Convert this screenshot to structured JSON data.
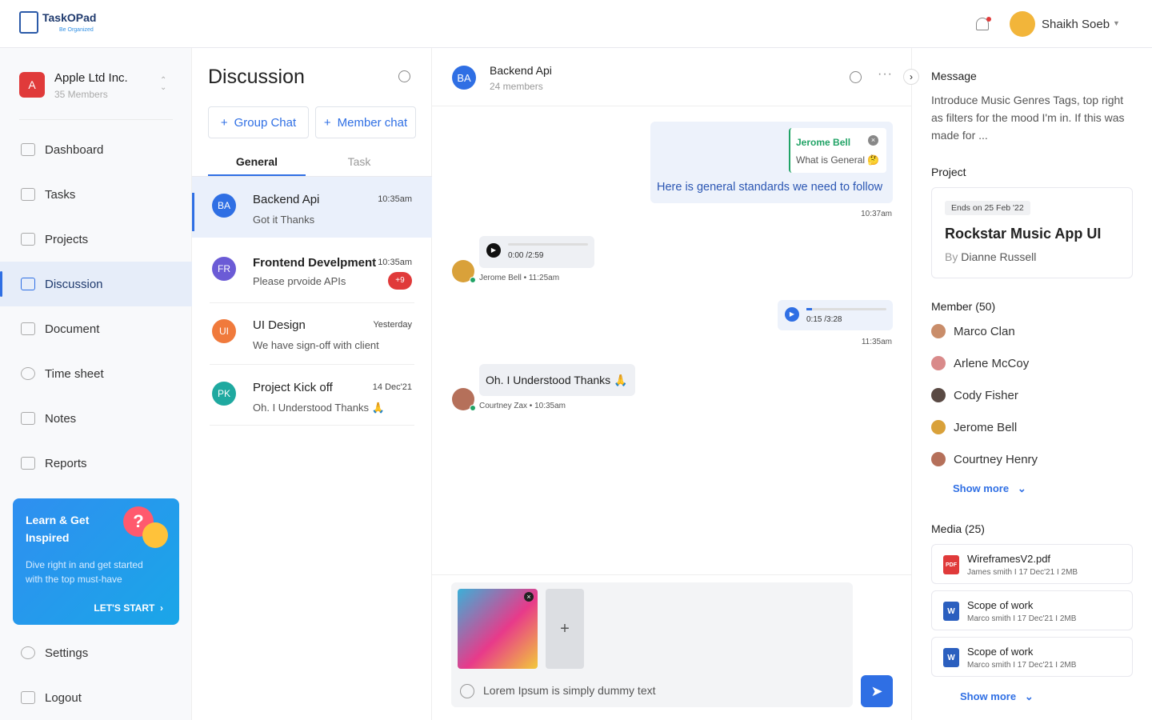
{
  "header": {
    "logo": "TaskOPad",
    "tagline": "Be Organized",
    "user": "Shaikh Soeb"
  },
  "workspace": {
    "initial": "A",
    "name": "Apple Ltd Inc.",
    "members": "35 Members"
  },
  "nav": [
    {
      "label": "Dashboard"
    },
    {
      "label": "Tasks"
    },
    {
      "label": "Projects"
    },
    {
      "label": "Discussion",
      "active": true
    },
    {
      "label": "Document"
    },
    {
      "label": "Time sheet"
    },
    {
      "label": "Notes"
    },
    {
      "label": "Reports"
    }
  ],
  "promo": {
    "title": "Learn & Get Inspired",
    "text": "Dive right in and get started with the top must-have",
    "cta": "LET'S START"
  },
  "bottom_nav": [
    {
      "label": "Settings"
    },
    {
      "label": "Logout"
    }
  ],
  "discussion": {
    "title": "Discussion",
    "group_chat": "Group Chat",
    "member_chat": "Member chat",
    "tabs": [
      "General",
      "Task"
    ],
    "items": [
      {
        "initials": "BA",
        "color": "#2f6fe4",
        "name": "Backend Api",
        "time": "10:35am",
        "msg": "Got it Thanks",
        "active": true
      },
      {
        "initials": "FR",
        "color": "#6b5bd6",
        "name": "Frontend Develpment",
        "time": "10:35am",
        "msg": "Please prvoide APIs",
        "badge": "+9"
      },
      {
        "initials": "UI",
        "color": "#f07a3c",
        "name": "UI Design",
        "time": "Yesterday",
        "msg": "We have sign-off with client"
      },
      {
        "initials": "PK",
        "color": "#1fa9a0",
        "name": "Project Kick off",
        "time": "14 Dec'21",
        "msg": "Oh. I Understood Thanks 🙏"
      }
    ]
  },
  "chat": {
    "initials": "BA",
    "title": "Backend Api",
    "members": "24 members",
    "reply_name": "Jerome Bell",
    "reply_text": "What is General 🤔",
    "msg1": "Here is general standards we need to follow",
    "time1": "10:37am",
    "audio1": "0:00 /2:59",
    "audio1_progress": 0,
    "meta2": "Jerome Bell • 11:25am",
    "audio2": "0:15 /3:28",
    "audio2_progress": 0.07,
    "time3": "11:35am",
    "msg4": "Oh. I Understood Thanks 🙏",
    "meta4": "Courtney Zax • 10:35am",
    "input": "Lorem Ipsum is simply dummy text"
  },
  "details": {
    "message_label": "Message",
    "message": "Introduce Music Genres Tags, top right as filters for the mood I'm in. If this was made for ...",
    "project_label": "Project",
    "project_ends": "Ends on 25 Feb '22",
    "project_name": "Rockstar Music App UI",
    "project_by": "By",
    "project_owner": "Dianne Russell",
    "member_label": "Member (50)",
    "members": [
      "Marco Clan",
      "Arlene McCoy",
      "Cody Fisher",
      "Jerome Bell",
      "Courtney Henry"
    ],
    "show_more": "Show more",
    "media_label": "Media (25)",
    "media": [
      {
        "name": "WireframesV2.pdf",
        "meta": "James smith  I 17 Dec'21 I 2MB",
        "type": "PDF"
      },
      {
        "name": "Scope of work",
        "meta": "Marco smith  I 17 Dec'21 I 2MB",
        "type": "W"
      },
      {
        "name": "Scope of work",
        "meta": "Marco smith  I 17 Dec'21 I 2MB",
        "type": "W"
      }
    ]
  },
  "colors": {
    "accent": "#2f6fe4",
    "danger": "#e03a3a",
    "green": "#21a366"
  }
}
